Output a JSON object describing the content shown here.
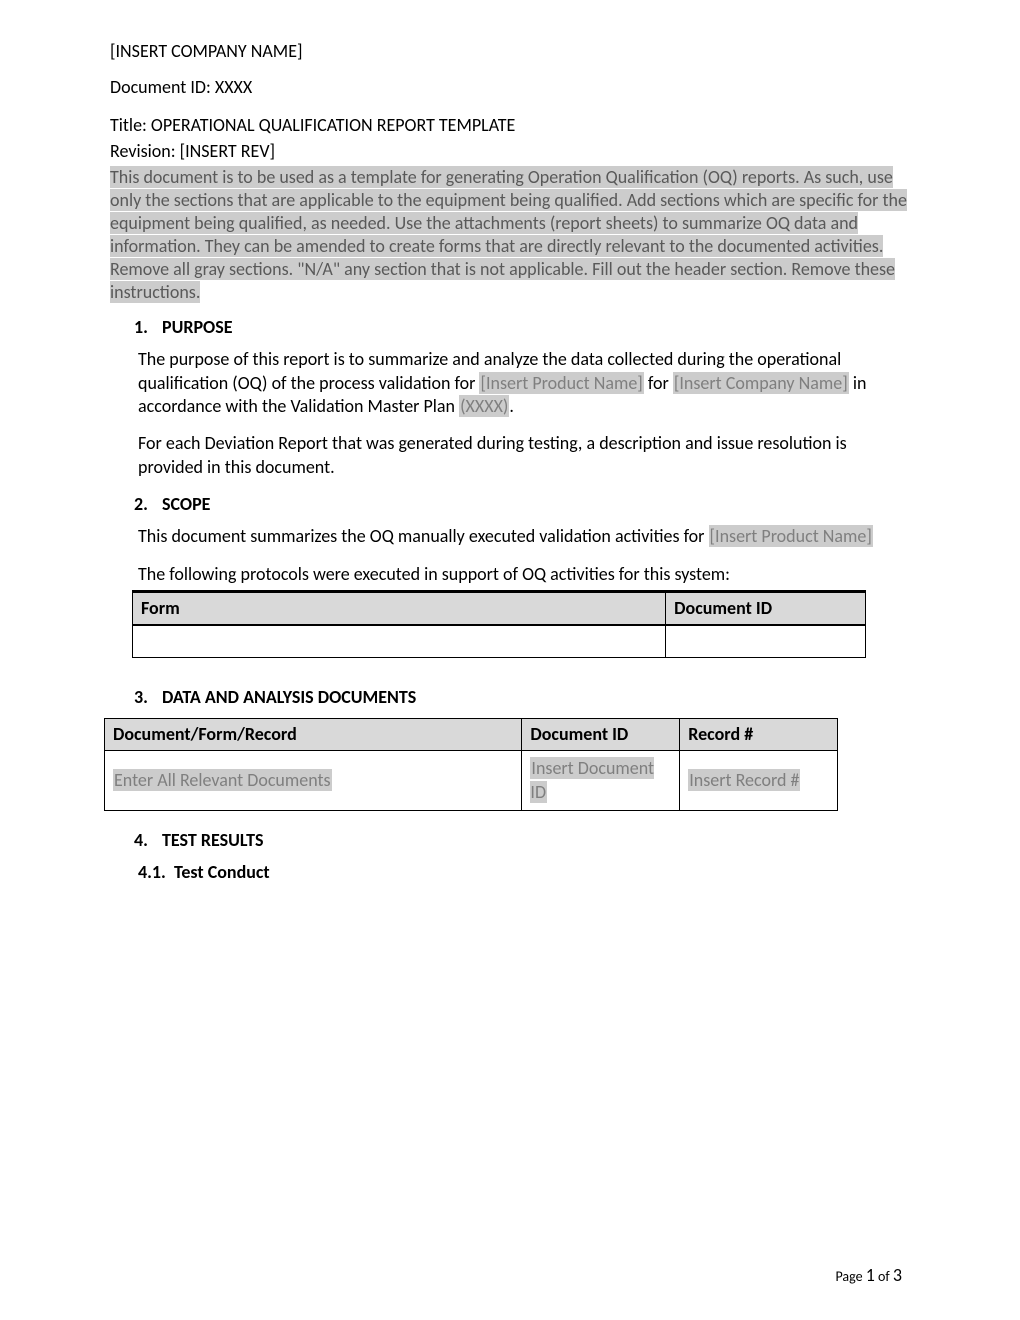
{
  "header": {
    "company": "[INSERT COMPANY NAME]",
    "doc_id_label": "Document ID: XXXX",
    "title": "Title: OPERATIONAL QUALIFICATION REPORT TEMPLATE",
    "revision": "Revision: [INSERT REV]"
  },
  "instructions": "This document is to be used as a template for generating Operation Qualification (OQ) reports. As such, use only the sections that are applicable to the equipment being qualified. Add sections which are specific for the equipment being qualified, as needed. Use the attachments (report sheets) to summarize OQ data and information. They can be amended to create forms that are directly relevant to the documented activities.  Remove all gray sections.  \"N/A\" any section that is not applicable.  Fill out the header section.  Remove these instructions.",
  "sections": {
    "s1": {
      "num": "1.",
      "title": "PURPOSE",
      "p1a": "The purpose of this report is to summarize and analyze the data collected during the operational qualification (OQ) of the process validation for ",
      "ph1": "[Insert Product Name]",
      "p1b": " for ",
      "ph2": "[Insert Company Name]",
      "p1c": " in accordance with the Validation Master Plan ",
      "ph3": "(XXXX)",
      "p1d": ".",
      "p2": "For each Deviation Report that was generated during testing, a description and issue resolution is provided in this document."
    },
    "s2": {
      "num": "2.",
      "title": "SCOPE",
      "p1a": "This document summarizes the OQ manually executed validation activities for ",
      "ph1": "[Insert Product Name]",
      "p2": "The following protocols were executed in support of OQ activities for this system:",
      "table": {
        "headers": {
          "c1": "Form",
          "c2": "Document ID"
        },
        "rows": [
          {
            "c1": "",
            "c2": ""
          }
        ]
      }
    },
    "s3": {
      "num": "3.",
      "title": "DATA AND ANALYSIS DOCUMENTS",
      "table": {
        "headers": {
          "c1": "Document/Form/Record",
          "c2": "Document ID",
          "c3": "Record #"
        },
        "rows": [
          {
            "c1": "Enter All Relevant Documents",
            "c2": "Insert Document ID",
            "c3": "Insert Record #"
          }
        ]
      }
    },
    "s4": {
      "num": "4.",
      "title": "TEST RESULTS",
      "sub": {
        "num": "4.1.",
        "title": "Test Conduct"
      }
    }
  },
  "footer": {
    "prefix": "Page ",
    "page": "1",
    "of": " of ",
    "total": "3"
  }
}
